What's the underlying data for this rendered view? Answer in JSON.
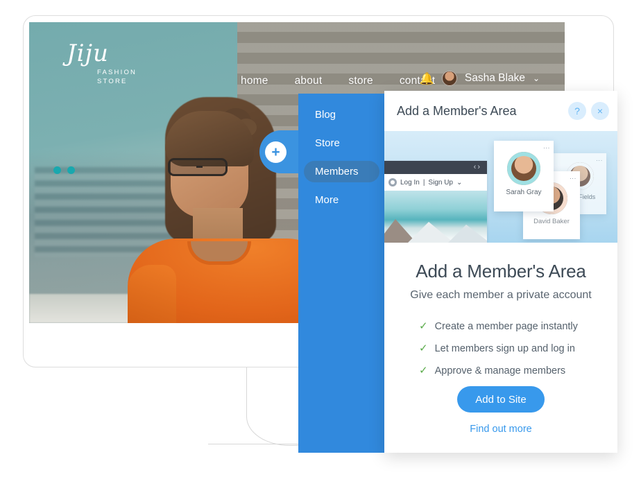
{
  "site": {
    "logo": {
      "name": "Jiju",
      "line1": "FASHION",
      "line2": "STORE"
    },
    "nav": [
      {
        "label": "home"
      },
      {
        "label": "about"
      },
      {
        "label": "store"
      },
      {
        "label": "contact"
      }
    ],
    "user": {
      "bell_icon": "bell-icon",
      "avatar": "user-avatar",
      "name": "Sasha Blake",
      "caret": "⌄"
    }
  },
  "add_button": {
    "icon": "plus-icon",
    "label": "+"
  },
  "sidebar": {
    "items": [
      {
        "label": "Blog",
        "selected": false
      },
      {
        "label": "Store",
        "selected": false
      },
      {
        "label": "Members",
        "selected": true
      },
      {
        "label": "More",
        "selected": false
      }
    ]
  },
  "panel": {
    "header": {
      "title": "Add a Member's Area",
      "help_label": "?",
      "close_label": "×"
    },
    "preview": {
      "browser": {
        "nav_back": "‹",
        "nav_forward": "›",
        "login_label": "Log In",
        "separator": "|",
        "signup_label": "Sign Up",
        "caret": "⌄"
      },
      "cards": [
        {
          "name": "Sarah Gray",
          "menu": "⋮"
        },
        {
          "name": "David Baker",
          "menu": "⋮"
        },
        {
          "name": "Amy Fields",
          "menu": "⋮"
        }
      ]
    },
    "promo": {
      "heading": "Add a Member's Area",
      "subheading": "Give each member a private account",
      "features": [
        {
          "check": "✓",
          "text": "Create a member page instantly"
        },
        {
          "check": "✓",
          "text": "Let members sign up and log in"
        },
        {
          "check": "✓",
          "text": "Approve & manage members"
        }
      ],
      "cta_label": "Add to Site",
      "link_label": "Find out more"
    }
  },
  "colors": {
    "sidebar_blue": "#3189dd",
    "cta_blue": "#3899ec",
    "selected_pill": "#3a7cb8",
    "check_green": "#5aab4a",
    "heading_gray": "#3d4a56"
  }
}
